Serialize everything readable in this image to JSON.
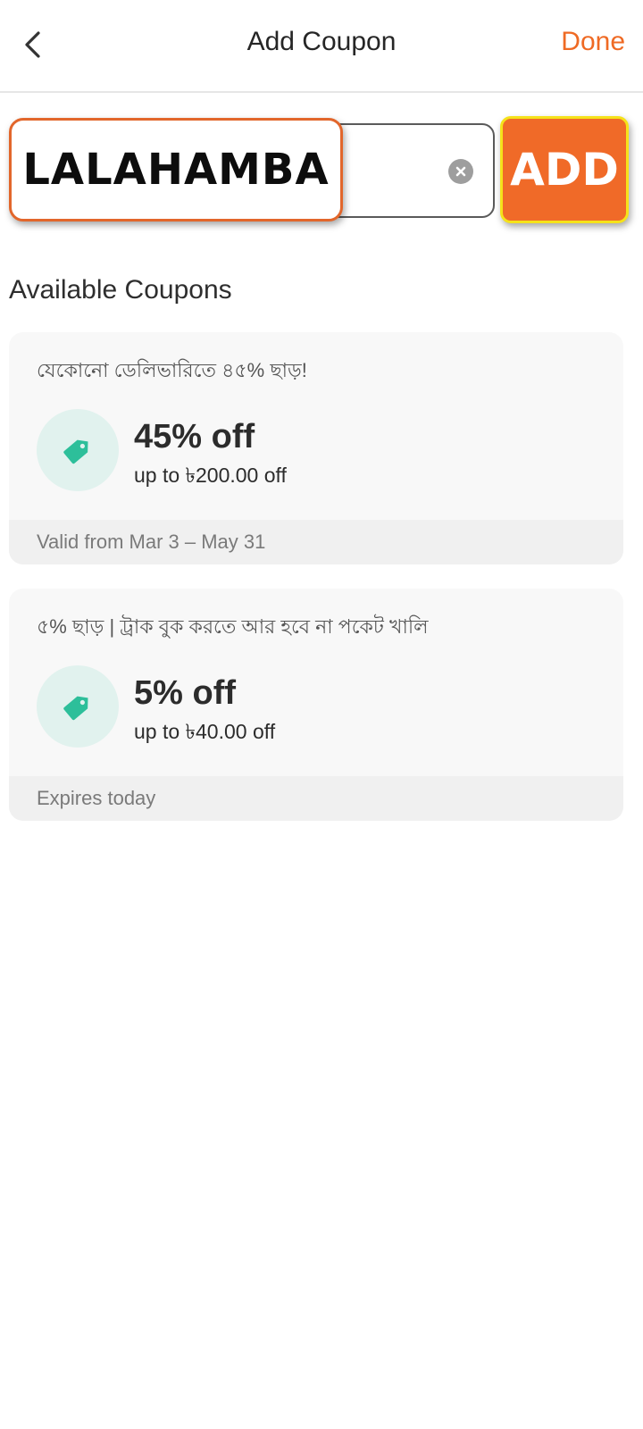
{
  "header": {
    "title": "Add Coupon",
    "done_label": "Done",
    "back_icon": "chevron-left-icon"
  },
  "entry": {
    "code_value": "LALAHAMBA",
    "add_label": "ADD",
    "clear_icon": "clear-circle-icon"
  },
  "section": {
    "title": "Available Coupons"
  },
  "coupons": [
    {
      "description": "যেকোনো ডেলিভারিতে ৪৫% ছাড়!",
      "discount": "45% off",
      "cap": "up to ৳200.00 off",
      "validity": "Valid from Mar 3 – May 31",
      "icon": "tag-icon"
    },
    {
      "description": "৫% ছাড় | ট্রাক বুক করতে আর হবে না পকেট খালি",
      "discount": "5% off",
      "cap": "up to ৳40.00 off",
      "validity": "Expires today",
      "icon": "tag-icon"
    }
  ],
  "colors": {
    "accent": "#ef6a24",
    "add_button": "#f06a28",
    "add_border": "#f5e21a",
    "tag": "#2dbf9a",
    "tag_bg": "#e1f2ee"
  }
}
